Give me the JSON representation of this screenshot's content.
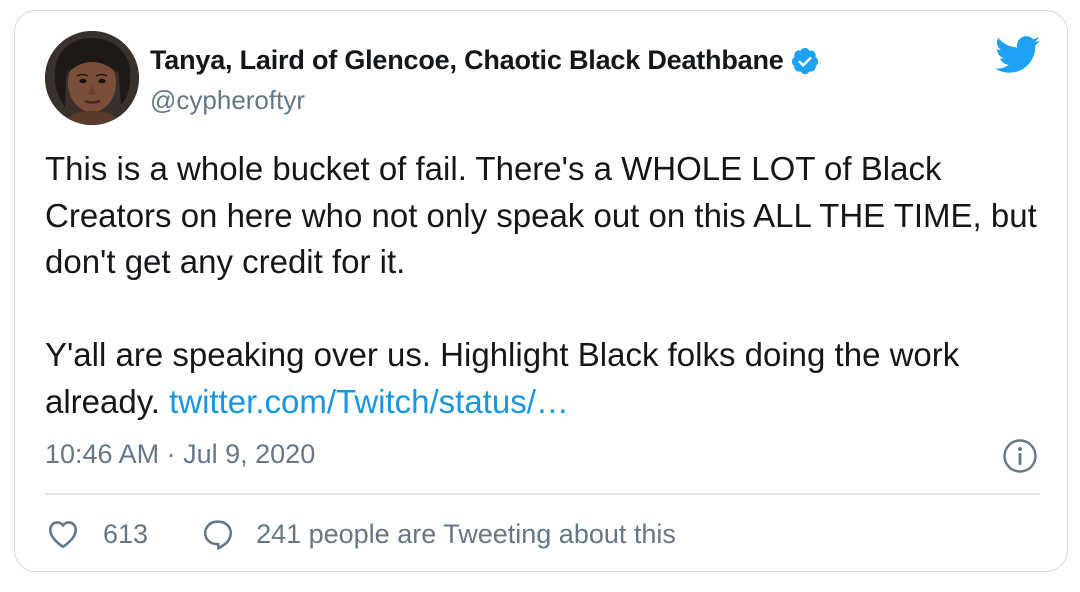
{
  "author": {
    "display_name": "Tanya, Laird of Glencoe, Chaotic Black Deathbane",
    "handle": "@cypheroftyr",
    "verified_icon": "verified-badge-icon",
    "avatar_icon": "profile-photo"
  },
  "brand": {
    "logo_icon": "twitter-bird-icon",
    "accent_color": "#1da1f2",
    "link_color": "#1b95e0",
    "text_color": "#14171a",
    "muted_color": "#657786"
  },
  "tweet": {
    "paragraph_1": "This is a whole bucket of fail. There's a WHOLE LOT of Black Creators on here who not only speak out on this ALL THE TIME, but don't get any credit for it.",
    "paragraph_2_text": "Y'all are speaking over us. Highlight Black folks doing the work already.",
    "paragraph_2_link": "twitter.com/Twitch/status/…"
  },
  "meta": {
    "time": "10:46 AM",
    "separator": "·",
    "date": "Jul 9, 2020",
    "info_icon": "info-icon"
  },
  "actions": {
    "like_icon": "heart-icon",
    "like_count": "613",
    "reply_icon": "speech-bubble-icon",
    "tweeting_text": "241 people are Tweeting about this"
  }
}
